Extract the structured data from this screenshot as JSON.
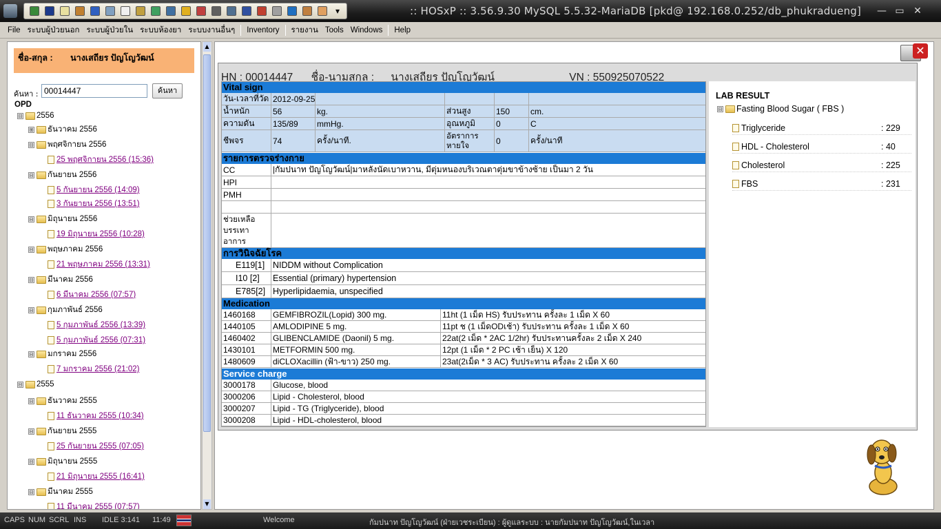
{
  "window": {
    "title": ":: HOSxP :: 3.56.9.30 MySQL 5.5.32-MariaDB [pkd@ 192.168.0.252/db_phukradueng]",
    "minimize": "▭",
    "maximize": "▭",
    "close": "✕"
  },
  "toolbar": {
    "icons": [
      "tool-icon",
      "film-icon",
      "note-icon",
      "person-edit-icon",
      "pencil-icon",
      "checklist-icon",
      "document-icon",
      "grid-icon",
      "table-icon",
      "calendar-icon",
      "lightning-icon",
      "user-icon",
      "list-icon",
      "chart-icon",
      "clock-icon",
      "home-icon",
      "search-doc-icon",
      "card-icon",
      "image-icon",
      "hand-icon"
    ],
    "overflow": "▾"
  },
  "menu": {
    "items": [
      "File",
      "ระบบผู้ป่วยนอก",
      "ระบบผู้ป่วยใน",
      "ระบบห้องยา",
      "ระบบงานอื่นๆ",
      "Inventory",
      "รายงาน",
      "Tools",
      "Windows",
      "Help"
    ]
  },
  "patient": {
    "name_label": "ชื่อ-สกุล :",
    "name": "นางเสถียร ปัญโญวัฒน์"
  },
  "search": {
    "label": "ค้นหา :",
    "value": "00014447",
    "button": "ค้นหา"
  },
  "tree": {
    "root": "OPD",
    "nodes": [
      {
        "type": "year",
        "label": "2556",
        "toggle": "⊟"
      },
      {
        "type": "month",
        "label": "ธันวาคม 2556",
        "toggle": "⊞"
      },
      {
        "type": "month",
        "label": "พฤศจิกายน 2556",
        "toggle": "⊟"
      },
      {
        "type": "visit",
        "label": "25 พฤศจิกายน 2556 (15:36)"
      },
      {
        "type": "month",
        "label": "กันยายน 2556",
        "toggle": "⊟"
      },
      {
        "type": "visit",
        "label": "5 กันยายน 2556 (14:09)"
      },
      {
        "type": "visit",
        "label": "3 กันยายน 2556 (13:51)"
      },
      {
        "type": "month",
        "label": "มิถุนายน 2556",
        "toggle": "⊟"
      },
      {
        "type": "visit",
        "label": "19 มิถุนายน 2556 (10:28)"
      },
      {
        "type": "month",
        "label": "พฤษภาคม 2556",
        "toggle": "⊟"
      },
      {
        "type": "visit",
        "label": "21 พฤษภาคม 2556 (13:31)"
      },
      {
        "type": "month",
        "label": "มีนาคม 2556",
        "toggle": "⊟"
      },
      {
        "type": "visit",
        "label": "6 มีนาคม 2556 (07:57)"
      },
      {
        "type": "month",
        "label": "กุมภาพันธ์ 2556",
        "toggle": "⊟"
      },
      {
        "type": "visit",
        "label": "5 กุมภาพันธ์ 2556 (13:39)"
      },
      {
        "type": "visit",
        "label": "5 กุมภาพันธ์ 2556 (07:31)"
      },
      {
        "type": "month",
        "label": "มกราคม 2556",
        "toggle": "⊟"
      },
      {
        "type": "visit",
        "label": "7 มกราคม 2556 (21:02)"
      },
      {
        "type": "year",
        "label": "2555",
        "toggle": "⊟"
      },
      {
        "type": "month",
        "label": "ธันวาคม 2555",
        "toggle": "⊟"
      },
      {
        "type": "visit",
        "label": "11 ธันวาคม 2555 (10:34)"
      },
      {
        "type": "month",
        "label": "กันยายน 2555",
        "toggle": "⊟"
      },
      {
        "type": "visit",
        "label": "25 กันยายน 2555 (07:05)"
      },
      {
        "type": "month",
        "label": "มิถุนายน 2555",
        "toggle": "⊟"
      },
      {
        "type": "visit",
        "label": "21 มิถุนายน 2555 (16:41)"
      },
      {
        "type": "month",
        "label": "มีนาคม 2555",
        "toggle": "⊟"
      },
      {
        "type": "visit",
        "label": "11 มีนาคม 2555 (07:57)"
      }
    ]
  },
  "record": {
    "hn": "HN : 00014447",
    "name_label": "ชื่อ-นามสกุล :",
    "name": "นางเสถียร ปัญโญวัฒน์",
    "vn": "VN : 550925070522",
    "vital": {
      "header": "Vital sign",
      "date_label": "วัน-เวลาที่วัด",
      "date": "2012-09-25",
      "weight_label": "น้ำหนัก",
      "weight": "56",
      "weight_unit": "kg.",
      "height_label": "ส่วนสูง",
      "height": "150",
      "height_unit": "cm.",
      "bp_label": "ความดัน",
      "bp": "135/89",
      "bp_unit": "mmHg.",
      "temp_label": "อุณหภูมิ",
      "temp": "0",
      "temp_unit": "C",
      "pulse_label": "ชีพจร",
      "pulse": "74",
      "pulse_unit": "ครั้ง/นาที.",
      "resp_label": "อัตราการหายใจ",
      "resp": "0",
      "resp_unit": "ครั้ง/นาที"
    },
    "exam": {
      "header": "รายการตรวจร่างกาย",
      "cc_label": "CC",
      "cc": "|กัมปนาท ปัญโญวัฒน์|มาหลังนัดเบาหวาน, มีตุ่มหนองบริเวณตาตุ่มขาข้างซ้าย เป็นมา 2 วัน",
      "hpi_label": "HPI",
      "pmh_label": "PMH",
      "help_label": "ช่วยเหลือ บรรเทา อาการ"
    },
    "dx": {
      "header": "การวินิจฉัยโรค",
      "items": [
        {
          "code": "E119[1]",
          "desc": "NIDDM without Complication"
        },
        {
          "code": "I10  [2]",
          "desc": "Essential (primary) hypertension"
        },
        {
          "code": "E785[2]",
          "desc": "Hyperlipidaemia, unspecified"
        }
      ]
    },
    "meds": {
      "header": "Medication",
      "items": [
        {
          "code": "1460168",
          "name": "GEMFIBROZIL(Lopid) 300 mg.",
          "usage": "11ht (1 เม็ด HS) รับประทาน ครั้งละ 1 เม็ด X 60"
        },
        {
          "code": "1440105",
          "name": "AMLODIPINE 5 mg.",
          "usage": "11pt ช (1 เม็ดODเช้า) รับประทาน ครั้งละ 1 เม็ด X 60"
        },
        {
          "code": "1460402",
          "name": "GLIBENCLAMIDE (Daonil) 5 mg.",
          "usage": "22at(2 เม็ด * 2AC 1/2hr) รับประทานครั้งละ 2 เม็ด X 240"
        },
        {
          "code": "1430101",
          "name": "METFORMIN 500 mg.",
          "usage": "12pt (1 เม็ด * 2 PC เช้า เย็น) X 120"
        },
        {
          "code": "1480609",
          "name": "diCLOXacillin (ฟ้า-ขาว) 250 mg.",
          "usage": "23at(2เม็ด * 3 AC) รับประทาน ครั้งละ 2 เม็ด X 60"
        }
      ]
    },
    "service": {
      "header": "Service charge",
      "items": [
        {
          "code": "3000178",
          "name": "Glucose, blood"
        },
        {
          "code": "3000206",
          "name": "Lipid - Cholesterol, blood"
        },
        {
          "code": "3000207",
          "name": "Lipid - TG (Triglyceride), blood"
        },
        {
          "code": "3000208",
          "name": "Lipid - HDL-cholesterol, blood"
        }
      ]
    }
  },
  "lab": {
    "title": "LAB RESULT",
    "group": "Fasting Blood Sugar ( FBS )",
    "group_toggle": "⊟",
    "items": [
      {
        "name": "Triglyceride",
        "value": ": 229"
      },
      {
        "name": "HDL - Cholesterol",
        "value": ": 40"
      },
      {
        "name": "Cholesterol",
        "value": ": 225"
      },
      {
        "name": "FBS",
        "value": ": 231"
      }
    ]
  },
  "status": {
    "caps": "CAPS",
    "num": "NUM",
    "scrl": "SCRL",
    "ins": "INS",
    "idle": "IDLE 3:141",
    "time": "11:49",
    "welcome": "Welcome",
    "user": "กัมปนาท ปัญโญวัฒน์ (ฝ่ายเวชระเบียน) : ผู้ดูแลระบบ : นายกัมปนาท ปัญโญวัฒน์,ในเวลา"
  }
}
